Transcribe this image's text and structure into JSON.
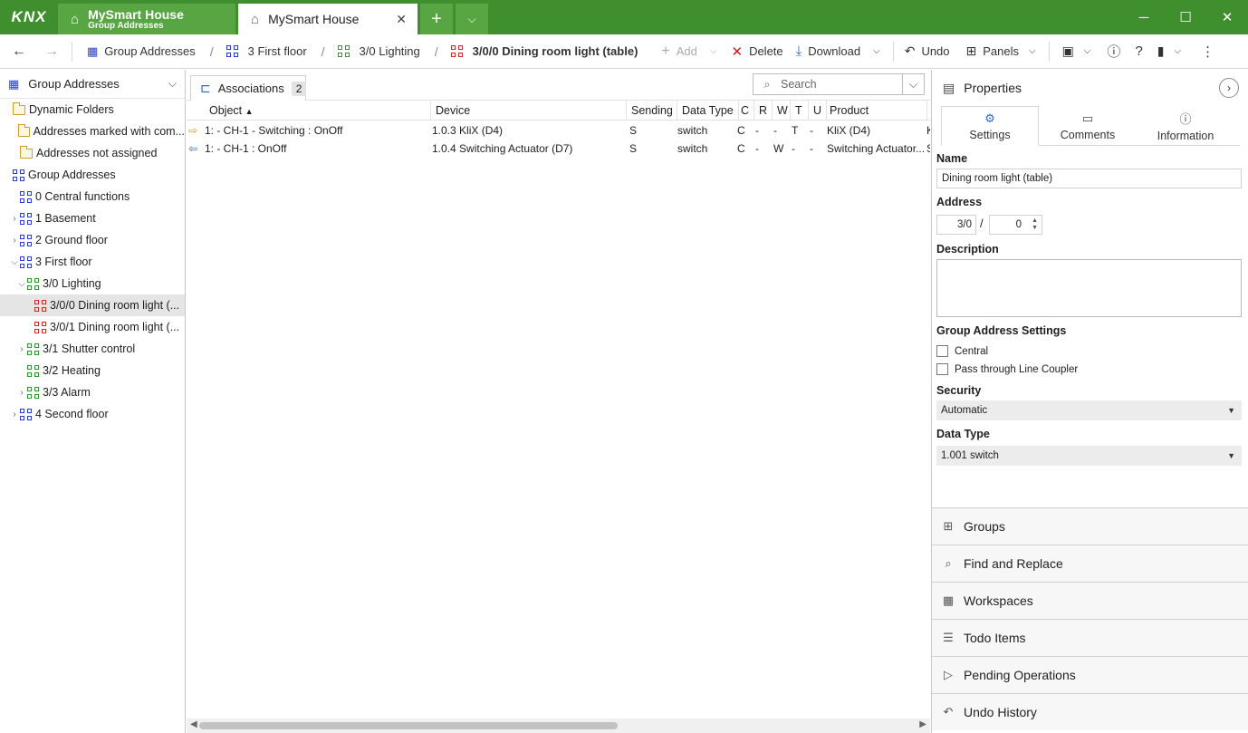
{
  "app": {
    "logo": "KNX",
    "tabs": [
      {
        "title": "MySmart House",
        "subtitle": "Group Addresses"
      },
      {
        "title": "MySmart House",
        "subtitle": ""
      }
    ],
    "window_controls": [
      "─",
      "☐",
      "✕"
    ]
  },
  "toolbar": {
    "breadcrumb": [
      "Group Addresses",
      "3 First floor",
      "3/0 Lighting",
      "3/0/0 Dining room light (table)"
    ],
    "add": "Add",
    "delete": "Delete",
    "download": "Download",
    "undo": "Undo",
    "panels": "Panels"
  },
  "left_panel": {
    "header": "Group Addresses",
    "items": [
      {
        "label": "Dynamic Folders",
        "icon": "folder-icon",
        "indent": 0,
        "chevron": "",
        "color": "folder"
      },
      {
        "label": "Addresses marked with com...",
        "icon": "folder-icon",
        "indent": 1,
        "chevron": "",
        "color": "folder"
      },
      {
        "label": "Addresses not assigned",
        "icon": "folder-icon",
        "indent": 1,
        "chevron": "",
        "color": "folder"
      },
      {
        "label": "Group Addresses",
        "icon": "group-icon",
        "indent": 0,
        "chevron": "",
        "color": "blue"
      },
      {
        "label": "0 Central functions",
        "icon": "group-icon",
        "indent": 1,
        "chevron": "",
        "color": "blue"
      },
      {
        "label": "1 Basement",
        "icon": "group-icon",
        "indent": 1,
        "chevron": "›",
        "color": "blue"
      },
      {
        "label": "2 Ground floor",
        "icon": "group-icon",
        "indent": 1,
        "chevron": "›",
        "color": "blue"
      },
      {
        "label": "3 First floor",
        "icon": "group-icon",
        "indent": 1,
        "chevron": "⌄",
        "color": "blue"
      },
      {
        "label": "3/0 Lighting",
        "icon": "group-icon",
        "indent": 2,
        "chevron": "⌄",
        "color": "green"
      },
      {
        "label": "3/0/0 Dining room light (...",
        "icon": "group-icon",
        "indent": 3,
        "chevron": "",
        "color": "red",
        "selected": true
      },
      {
        "label": "3/0/1 Dining room light (...",
        "icon": "group-icon",
        "indent": 3,
        "chevron": "",
        "color": "red"
      },
      {
        "label": "3/1 Shutter control",
        "icon": "group-icon",
        "indent": 2,
        "chevron": "›",
        "color": "green"
      },
      {
        "label": "3/2 Heating",
        "icon": "group-icon",
        "indent": 2,
        "chevron": "",
        "color": "green"
      },
      {
        "label": "3/3 Alarm",
        "icon": "group-icon",
        "indent": 2,
        "chevron": "›",
        "color": "green"
      },
      {
        "label": "4 Second floor",
        "icon": "group-icon",
        "indent": 1,
        "chevron": "›",
        "color": "blue"
      }
    ]
  },
  "center": {
    "tab_label": "Associations",
    "tab_count": "2",
    "search_placeholder": "Search",
    "columns": [
      "Object",
      "Device",
      "Sending",
      "Data Type",
      "C",
      "R",
      "W",
      "T",
      "U",
      "Product"
    ],
    "rows": [
      [
        "1: - CH-1 - Switching : OnOff",
        "1.0.3 KliX (D4)",
        "S",
        "switch",
        "C",
        "-",
        "-",
        "T",
        "-",
        "KliX (D4)",
        "K"
      ],
      [
        "1: - CH-1 : OnOff",
        "1.0.4 Switching Actuator (D7)",
        "S",
        "switch",
        "C",
        "-",
        "W",
        "-",
        "-",
        "Switching Actuator...",
        "S"
      ]
    ]
  },
  "properties": {
    "header": "Properties",
    "tabs": [
      "Settings",
      "Comments",
      "Information"
    ],
    "name_label": "Name",
    "name_value": "Dining room light (table)",
    "address_label": "Address",
    "address_main": "3/0",
    "address_sep": "/",
    "address_sub": "0",
    "description_label": "Description",
    "ga_settings_label": "Group Address Settings",
    "central": "Central",
    "pass_through": "Pass through Line Coupler",
    "security_label": "Security",
    "security_value": "Automatic",
    "datatype_label": "Data Type",
    "datatype_value": "1.001 switch"
  },
  "accordion": [
    "Groups",
    "Find and Replace",
    "Workspaces",
    "Todo Items",
    "Pending Operations",
    "Undo History"
  ]
}
